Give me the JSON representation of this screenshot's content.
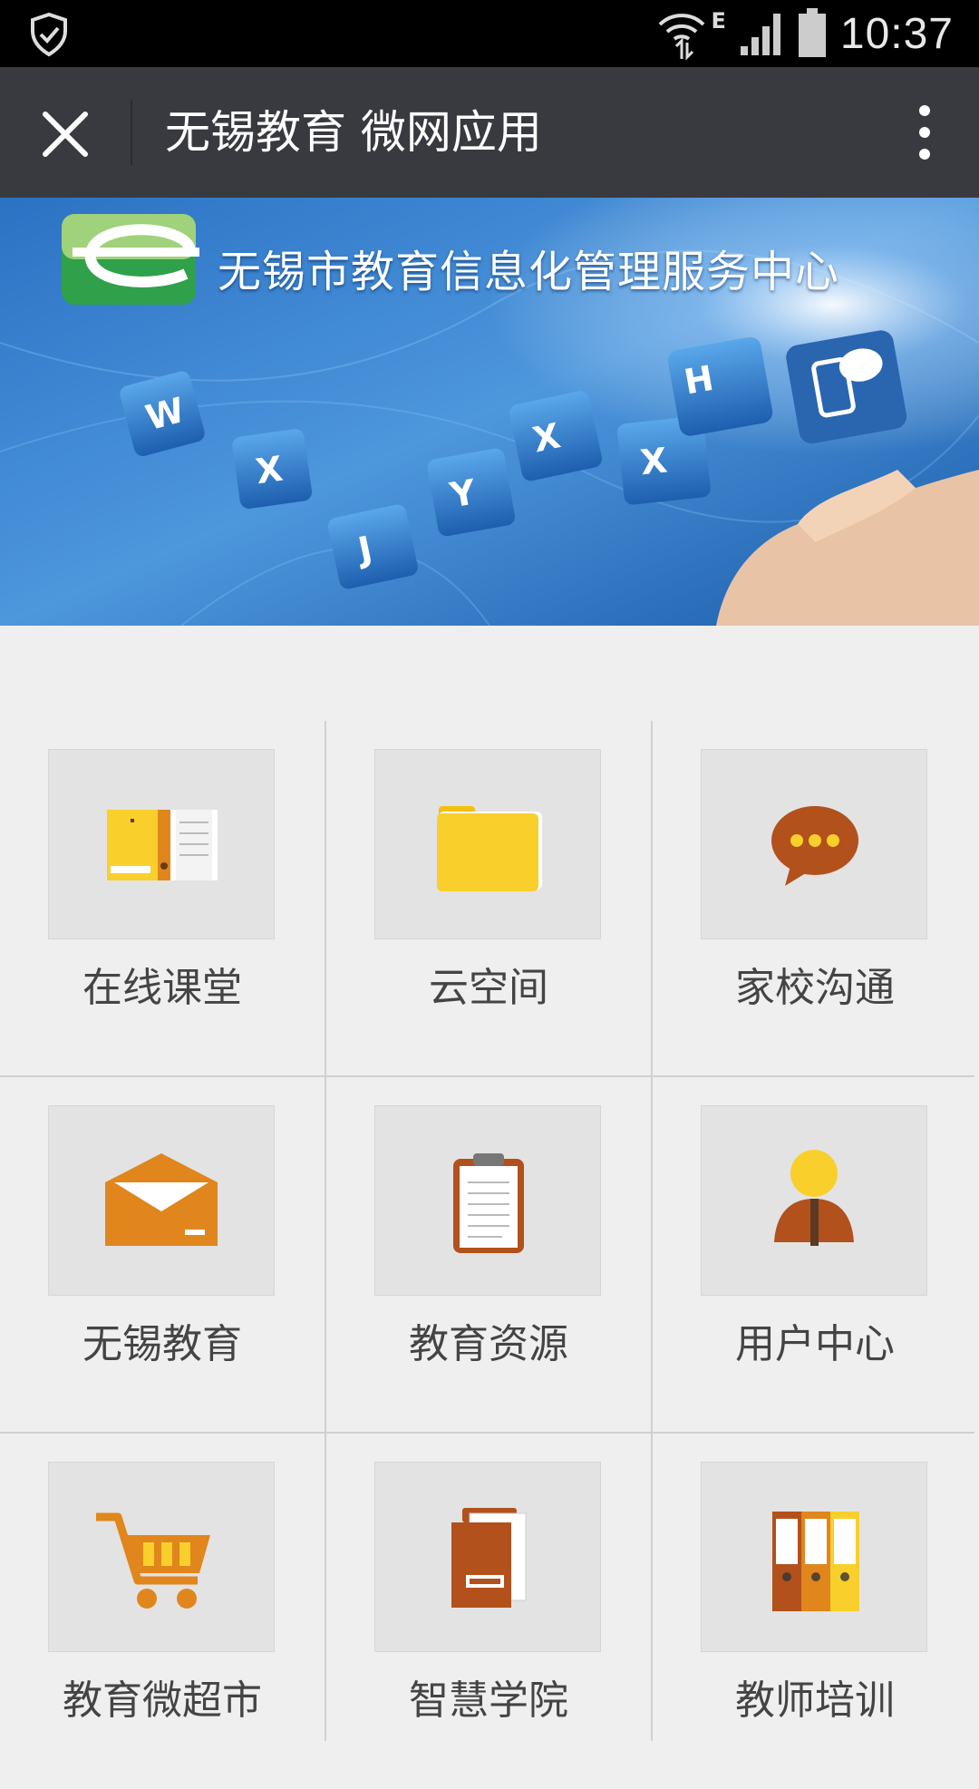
{
  "status_bar": {
    "time": "10:37",
    "network_type": "E",
    "icons": [
      "shield-check-icon",
      "wifi-icon",
      "signal-icon",
      "battery-icon"
    ]
  },
  "app_bar": {
    "title": "无锡教育 微网应用",
    "close_icon": "close-icon",
    "more_icon": "more-vertical-icon"
  },
  "banner": {
    "title": "无锡市教育信息化管理服务中心",
    "key_letters": [
      "W",
      "X",
      "J",
      "Y",
      "X",
      "X",
      "H"
    ]
  },
  "grid": {
    "items": [
      {
        "label": "在线课堂",
        "icon": "notebook-icon"
      },
      {
        "label": "云空间",
        "icon": "folder-icon"
      },
      {
        "label": "家校沟通",
        "icon": "chat-bubble-icon"
      },
      {
        "label": "无锡教育",
        "icon": "envelope-icon"
      },
      {
        "label": "教育资源",
        "icon": "clipboard-icon"
      },
      {
        "label": "用户中心",
        "icon": "user-icon"
      },
      {
        "label": "教育微超市",
        "icon": "shopping-cart-icon"
      },
      {
        "label": "智慧学院",
        "icon": "book-folder-icon"
      },
      {
        "label": "教师培训",
        "icon": "binders-icon"
      }
    ]
  },
  "colors": {
    "app_bar": "#393a3f",
    "status_bar": "#000000",
    "page_bg": "#efefef",
    "tile_bg": "#e3e3e3",
    "orange": "#e0861c",
    "yellow": "#f9cf2c",
    "brown": "#a8501f"
  }
}
